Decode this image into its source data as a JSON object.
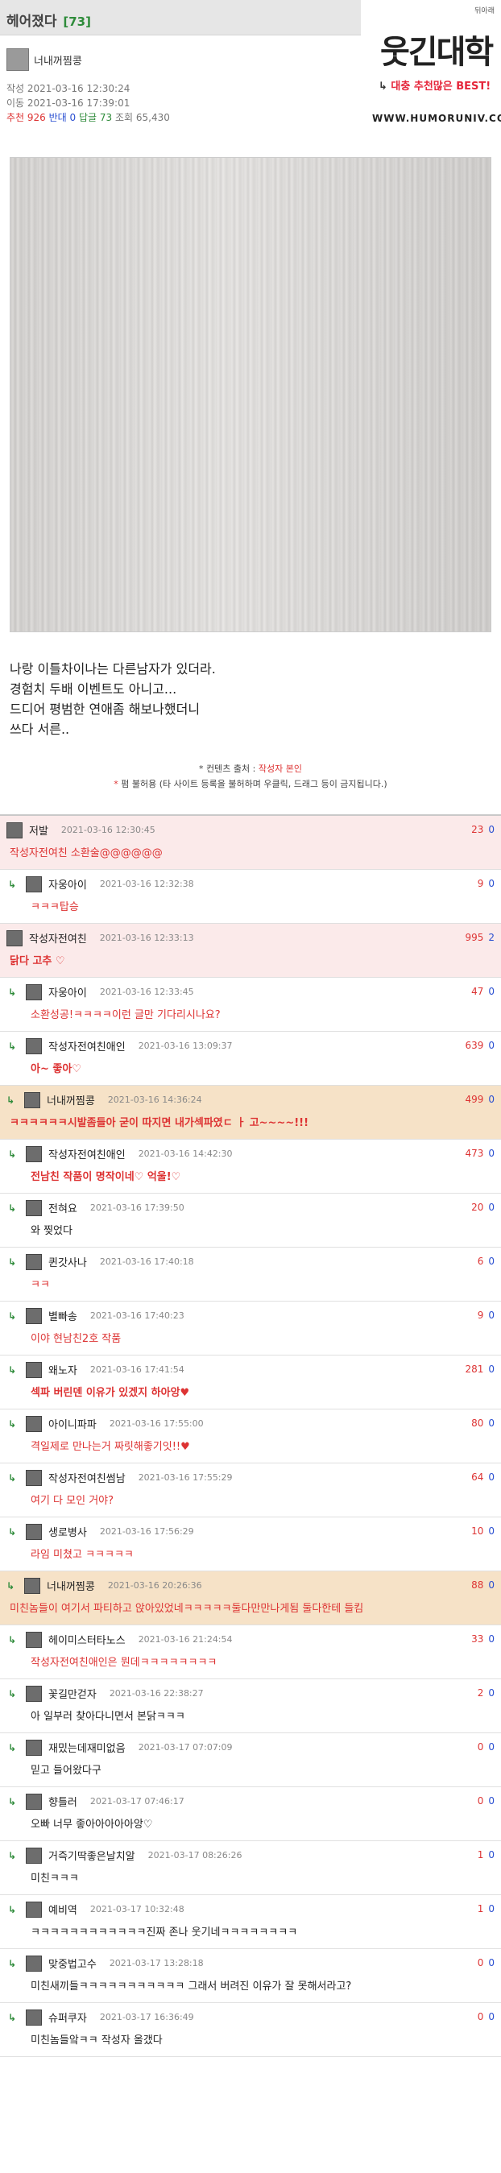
{
  "post": {
    "title": "헤어졌다",
    "comment_count": "[73]",
    "author": "너내꺼찜콩",
    "created": "작성 2021-03-16 12:30:24",
    "moved": "이동 2021-03-16 17:39:01",
    "stats": {
      "recommend": "추천 926",
      "oppose": "반대 0",
      "replies": "답글 73",
      "views": "조회 65,430"
    },
    "body": [
      "나랑 이틀차이나는 다른남자가 있더라.",
      "경험치 두배 이벤트도 아니고...",
      "드디어 평범한 연애좀 해보나했더니",
      "쓰다 서른.."
    ],
    "source_prefix": "* 컨텐츠 출처 : ",
    "source_author": "작성자 본인",
    "notice": "* 펌 불허용 (타 사이트 등록을 불허하며 우클릭, 드래그 등이 금지됩니다.)"
  },
  "logo": {
    "corner": "뒤아래",
    "main": "웃긴대학",
    "sub": "대충 추천많은 BEST!",
    "url": "WWW.HUMORUNIV.COM"
  },
  "comments": [
    {
      "nick": "저발",
      "date": "2021-03-16 12:30:45",
      "up": "23",
      "down": "0",
      "text": "작성자전여친 소환술@@@@@@",
      "type": "best",
      "textcls": "red"
    },
    {
      "nick": "자웅아이",
      "date": "2021-03-16 12:32:38",
      "up": "9",
      "down": "0",
      "text": "ㅋㅋㅋ탑승",
      "type": "reply",
      "textcls": "red"
    },
    {
      "nick": "작성자전여친",
      "date": "2021-03-16 12:33:13",
      "up": "995",
      "down": "2",
      "text": "닭다 고추 ♡",
      "type": "best",
      "textcls": "red bold"
    },
    {
      "nick": "자웅아이",
      "date": "2021-03-16 12:33:45",
      "up": "47",
      "down": "0",
      "text": "소환성공!ㅋㅋㅋㅋ이런 글만 기다리시나요?",
      "type": "reply",
      "textcls": "red"
    },
    {
      "nick": "작성자전여친애인",
      "date": "2021-03-16 13:09:37",
      "up": "639",
      "down": "0",
      "text": "아~ 좋아♡",
      "type": "reply",
      "textcls": "red bold"
    },
    {
      "nick": "너내꺼찜콩",
      "date": "2021-03-16 14:36:24",
      "up": "499",
      "down": "0",
      "text": "ㅋㅋㅋㅋㅋㅋ시발좀들아 굳이 따지면 내가섹파였ㄷ ㅏ 고~~~~!!!",
      "type": "hl",
      "textcls": "red bold"
    },
    {
      "nick": "작성자전여친애인",
      "date": "2021-03-16 14:42:30",
      "up": "473",
      "down": "0",
      "text": "전남친 작품이 명작이네♡ 억울!♡",
      "type": "reply",
      "textcls": "red bold"
    },
    {
      "nick": "전혀요",
      "date": "2021-03-16 17:39:50",
      "up": "20",
      "down": "0",
      "text": "와 찢었다",
      "type": "reply",
      "textcls": ""
    },
    {
      "nick": "퀸갓사나",
      "date": "2021-03-16 17:40:18",
      "up": "6",
      "down": "0",
      "text": "ㅋㅋ",
      "type": "reply",
      "textcls": "red"
    },
    {
      "nick": "별빠송",
      "date": "2021-03-16 17:40:23",
      "up": "9",
      "down": "0",
      "text": "이야 현남친2호 작품",
      "type": "reply",
      "textcls": "red"
    },
    {
      "nick": "왜노자",
      "date": "2021-03-16 17:41:54",
      "up": "281",
      "down": "0",
      "text": "섹파 버린덴 이유가 있겠지 하아앙♥",
      "type": "reply",
      "textcls": "red bold"
    },
    {
      "nick": "아이니파파",
      "date": "2021-03-16 17:55:00",
      "up": "80",
      "down": "0",
      "text": "격일제로 만나는거 짜릿해좋기잇!!♥",
      "type": "reply",
      "textcls": "red"
    },
    {
      "nick": "작성자전여친썸남",
      "date": "2021-03-16 17:55:29",
      "up": "64",
      "down": "0",
      "text": "여기 다 모인 거야?",
      "type": "reply",
      "textcls": "red"
    },
    {
      "nick": "생로병사",
      "date": "2021-03-16 17:56:29",
      "up": "10",
      "down": "0",
      "text": "라임 미쳤고 ㅋㅋㅋㅋㅋ",
      "type": "reply",
      "textcls": "red"
    },
    {
      "nick": "너내꺼찜콩",
      "date": "2021-03-16 20:26:36",
      "up": "88",
      "down": "0",
      "text": "미친놈들이 여기서 파티하고 앉아있었네ㅋㅋㅋㅋㅋ둘다만만나게됨 둘다한테 들킴",
      "type": "hl",
      "textcls": "red"
    },
    {
      "nick": "헤이미스터타노스",
      "date": "2021-03-16 21:24:54",
      "up": "33",
      "down": "0",
      "text": "작성자전여친애인은 뭔데ㅋㅋㅋㅋㅋㅋㅋㅋ",
      "type": "reply",
      "textcls": "red"
    },
    {
      "nick": "꽃길만걷자",
      "date": "2021-03-16 22:38:27",
      "up": "2",
      "down": "0",
      "text": "아 일부러 찾아다니면서 본닭ㅋㅋㅋ",
      "type": "reply",
      "textcls": ""
    },
    {
      "nick": "재밌는데재미없음",
      "date": "2021-03-17 07:07:09",
      "up": "0",
      "down": "0",
      "text": "믿고 들어왔다구",
      "type": "reply",
      "textcls": ""
    },
    {
      "nick": "향틀러",
      "date": "2021-03-17 07:46:17",
      "up": "0",
      "down": "0",
      "text": "오빠 너무 좋아아아아아앙♡",
      "type": "reply",
      "textcls": ""
    },
    {
      "nick": "거즉기딱좋은날치알",
      "date": "2021-03-17 08:26:26",
      "up": "1",
      "down": "0",
      "text": "미친ㅋㅋㅋ",
      "type": "reply",
      "textcls": ""
    },
    {
      "nick": "예비역",
      "date": "2021-03-17 10:32:48",
      "up": "1",
      "down": "0",
      "text": "ㅋㅋㅋㅋㅋㅋㅋㅋㅋㅋㅋㅋ진짜 존나 웃기네ㅋㅋㅋㅋㅋㅋㅋㅋ",
      "type": "reply",
      "textcls": ""
    },
    {
      "nick": "맞중법고수",
      "date": "2021-03-17 13:28:18",
      "up": "0",
      "down": "0",
      "text": "미친새끼들ㅋㅋㅋㅋㅋㅋㅋㅋㅋㅋㅋ 그래서 버려진 이유가 잘 못해서라고?",
      "type": "reply",
      "textcls": ""
    },
    {
      "nick": "슈퍼쿠자",
      "date": "2021-03-17 16:36:49",
      "up": "0",
      "down": "0",
      "text": "미친놈들앜ㅋㅋ 작성자 올갰다",
      "type": "reply",
      "textcls": ""
    }
  ],
  "colors": {
    "accent_red": "#d33",
    "accent_blue": "#2a4fd1",
    "accent_green": "#2e8b3a",
    "best_bg": "#fbeaea",
    "highlight_bg": "#f6e2c7"
  }
}
